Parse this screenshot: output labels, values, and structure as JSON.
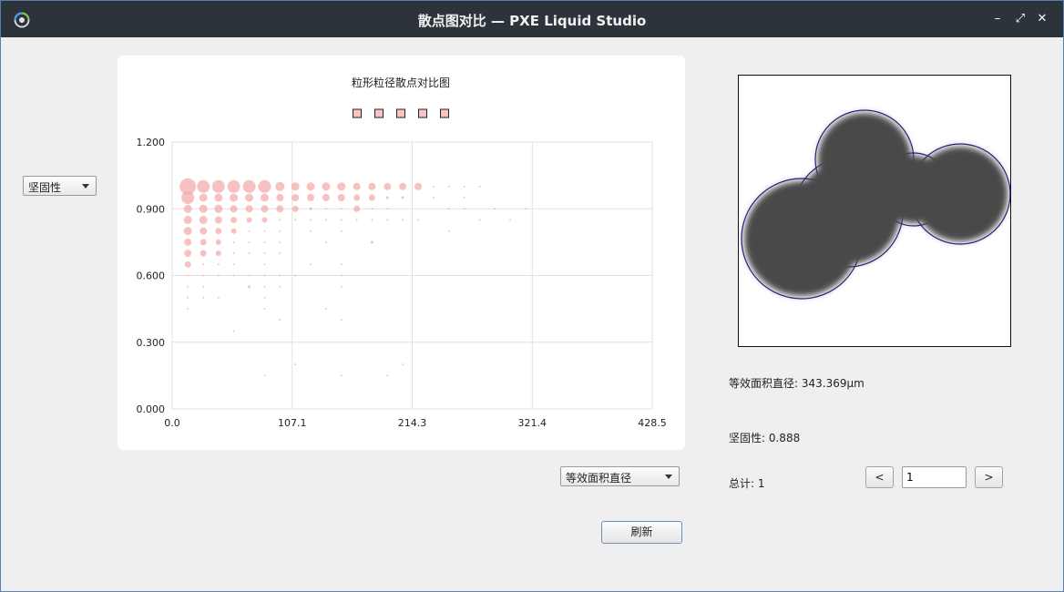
{
  "window": {
    "title": "散点图对比 — PXE Liquid Studio",
    "controls": {
      "minimize": "–",
      "restore": "⤢",
      "close": "✕"
    }
  },
  "left_combo": {
    "selected": "坚固性"
  },
  "bottom_combo": {
    "selected": "等效面积直径"
  },
  "refresh_label": "刷新",
  "info": {
    "diameter": "等效面积直径: 343.369μm",
    "solidity": "坚固性: 0.888",
    "total": "总计:  1"
  },
  "pager": {
    "prev": "<",
    "next": ">",
    "page": "1"
  },
  "colors": {
    "marker": "#f4a6a6",
    "legend_fill": "#f7c4c4",
    "shape": "#4a4a4a",
    "outline": "#1a1a8a"
  },
  "chart_data": {
    "type": "scatter",
    "title": "粒形粒径散点对比图",
    "legend_markers": 5,
    "legend_placement": "top-center",
    "xlim": [
      0,
      428.5
    ],
    "ylim": [
      0,
      1.2
    ],
    "x_ticks": [
      "0.0",
      "107.1",
      "214.3",
      "321.4",
      "428.5"
    ],
    "y_ticks": [
      "0.000",
      "0.300",
      "0.600",
      "0.900",
      "1.200"
    ],
    "grid": true,
    "points": [
      [
        14,
        1.0,
        9
      ],
      [
        27.8,
        1.0,
        7
      ],
      [
        41.3,
        1.0,
        7
      ],
      [
        55,
        1.0,
        7
      ],
      [
        68.8,
        1.0,
        7
      ],
      [
        82.5,
        1.0,
        7
      ],
      [
        96.2,
        1.0,
        5
      ],
      [
        109.9,
        1.0,
        4.5
      ],
      [
        123.6,
        1.0,
        4.5
      ],
      [
        137.3,
        1.0,
        4.5
      ],
      [
        151,
        1.0,
        4.5
      ],
      [
        164.7,
        1.0,
        4
      ],
      [
        178.4,
        1.0,
        4
      ],
      [
        192.1,
        1.0,
        4
      ],
      [
        205.8,
        1.0,
        4
      ],
      [
        219.5,
        1.0,
        4
      ],
      [
        233.2,
        1.0,
        1
      ],
      [
        247,
        1.0,
        1
      ],
      [
        260.7,
        1.0,
        1
      ],
      [
        274.5,
        1.0,
        1
      ],
      [
        14,
        0.95,
        7
      ],
      [
        27.8,
        0.95,
        4.5
      ],
      [
        41.3,
        0.95,
        4.5
      ],
      [
        55,
        0.95,
        4.5
      ],
      [
        68.8,
        0.95,
        4.5
      ],
      [
        82.5,
        0.95,
        4.5
      ],
      [
        96.2,
        0.95,
        4
      ],
      [
        109.9,
        0.95,
        4
      ],
      [
        123.6,
        0.95,
        4
      ],
      [
        137.3,
        0.95,
        4
      ],
      [
        151,
        0.95,
        4
      ],
      [
        164.7,
        0.95,
        3.5
      ],
      [
        178.4,
        0.95,
        3.5
      ],
      [
        192.1,
        0.95,
        1.5
      ],
      [
        205.8,
        0.95,
        1.5
      ],
      [
        233.2,
        0.95,
        1
      ],
      [
        260.7,
        0.95,
        1
      ],
      [
        14,
        0.9,
        4.5
      ],
      [
        27.8,
        0.9,
        4.5
      ],
      [
        41.3,
        0.9,
        4.5
      ],
      [
        55,
        0.9,
        4
      ],
      [
        68.8,
        0.9,
        4
      ],
      [
        82.5,
        0.9,
        4
      ],
      [
        96.2,
        0.9,
        4
      ],
      [
        109.9,
        0.9,
        3.5
      ],
      [
        123.6,
        0.9,
        1.5
      ],
      [
        137.3,
        0.9,
        1
      ],
      [
        151,
        0.9,
        1
      ],
      [
        164.7,
        0.9,
        3.5
      ],
      [
        178.4,
        0.9,
        1
      ],
      [
        192.1,
        0.9,
        1
      ],
      [
        247,
        0.9,
        1
      ],
      [
        260.7,
        0.9,
        1
      ],
      [
        288,
        0.9,
        1
      ],
      [
        315.5,
        0.9,
        1
      ],
      [
        14,
        0.85,
        4.5
      ],
      [
        27.8,
        0.85,
        4.5
      ],
      [
        41.3,
        0.85,
        4
      ],
      [
        55,
        0.85,
        3.5
      ],
      [
        68.8,
        0.85,
        3
      ],
      [
        82.5,
        0.85,
        3
      ],
      [
        96.2,
        0.85,
        1
      ],
      [
        109.9,
        0.85,
        1
      ],
      [
        123.6,
        0.85,
        1
      ],
      [
        137.3,
        0.85,
        1
      ],
      [
        151,
        0.85,
        1
      ],
      [
        164.7,
        0.85,
        1
      ],
      [
        178.4,
        0.85,
        1
      ],
      [
        192.1,
        0.85,
        1
      ],
      [
        205.8,
        0.85,
        1
      ],
      [
        219.5,
        0.85,
        1
      ],
      [
        274.5,
        0.85,
        1
      ],
      [
        301.8,
        0.85,
        1
      ],
      [
        14,
        0.8,
        4.5
      ],
      [
        27.8,
        0.8,
        4
      ],
      [
        41.3,
        0.8,
        3.5
      ],
      [
        55,
        0.8,
        3
      ],
      [
        68.8,
        0.8,
        1
      ],
      [
        82.5,
        0.8,
        1
      ],
      [
        96.2,
        0.8,
        1
      ],
      [
        123.6,
        0.8,
        1
      ],
      [
        151,
        0.8,
        1
      ],
      [
        247,
        0.8,
        1
      ],
      [
        14,
        0.75,
        4
      ],
      [
        27.8,
        0.75,
        3.5
      ],
      [
        41.3,
        0.75,
        3
      ],
      [
        55,
        0.75,
        1
      ],
      [
        68.8,
        0.75,
        1
      ],
      [
        82.5,
        0.75,
        1
      ],
      [
        96.2,
        0.75,
        1
      ],
      [
        137.3,
        0.75,
        1
      ],
      [
        178.4,
        0.75,
        1.5
      ],
      [
        14,
        0.7,
        4
      ],
      [
        27.8,
        0.7,
        3.5
      ],
      [
        41.3,
        0.7,
        3
      ],
      [
        55,
        0.7,
        1
      ],
      [
        68.8,
        0.7,
        1
      ],
      [
        82.5,
        0.7,
        1
      ],
      [
        96.2,
        0.7,
        1
      ],
      [
        14,
        0.65,
        3.5
      ],
      [
        27.8,
        0.65,
        1
      ],
      [
        41.3,
        0.65,
        1
      ],
      [
        55,
        0.65,
        1
      ],
      [
        82.5,
        0.65,
        1
      ],
      [
        123.6,
        0.65,
        1
      ],
      [
        151,
        0.65,
        1
      ],
      [
        14,
        0.6,
        1
      ],
      [
        27.8,
        0.6,
        1
      ],
      [
        41.3,
        0.6,
        1
      ],
      [
        55,
        0.6,
        1
      ],
      [
        68.8,
        0.6,
        1
      ],
      [
        82.5,
        0.6,
        1
      ],
      [
        96.2,
        0.6,
        1
      ],
      [
        109.9,
        0.6,
        1
      ],
      [
        151,
        0.6,
        1
      ],
      [
        14,
        0.55,
        1
      ],
      [
        27.8,
        0.55,
        1
      ],
      [
        68.8,
        0.55,
        1.5
      ],
      [
        82.5,
        0.55,
        1
      ],
      [
        96.2,
        0.55,
        1
      ],
      [
        151,
        0.55,
        1
      ],
      [
        14,
        0.5,
        1
      ],
      [
        27.8,
        0.5,
        1
      ],
      [
        41.3,
        0.5,
        1
      ],
      [
        82.5,
        0.5,
        1
      ],
      [
        14,
        0.45,
        1
      ],
      [
        82.5,
        0.45,
        1
      ],
      [
        137.3,
        0.45,
        1
      ],
      [
        96.2,
        0.4,
        1
      ],
      [
        151,
        0.4,
        1
      ],
      [
        55,
        0.35,
        1
      ],
      [
        109.9,
        0.2,
        1
      ],
      [
        206,
        0.2,
        1
      ],
      [
        82.5,
        0.15,
        1
      ],
      [
        151,
        0.15,
        1
      ],
      [
        192.1,
        0.15,
        1
      ]
    ]
  }
}
